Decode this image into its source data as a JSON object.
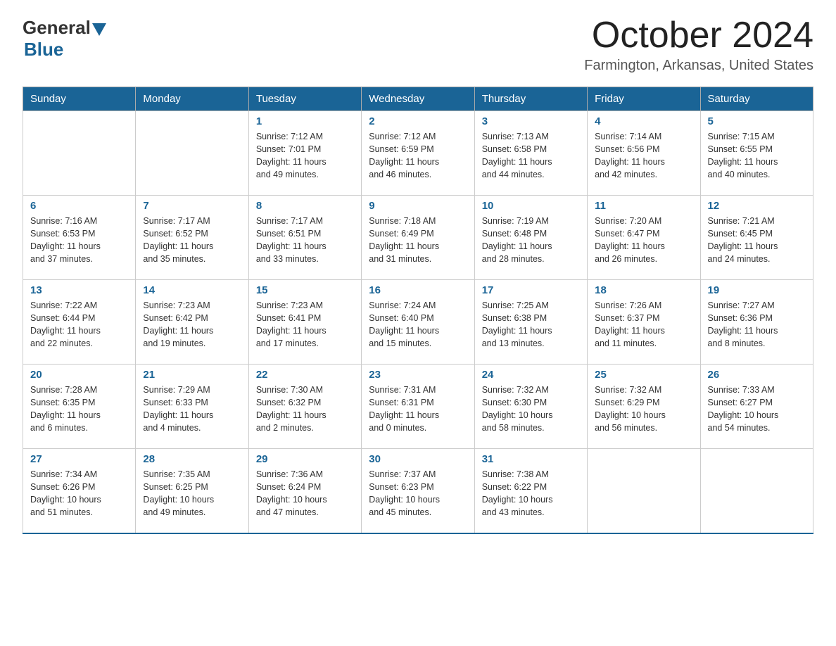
{
  "header": {
    "logo_general": "General",
    "logo_blue": "Blue",
    "month_title": "October 2024",
    "location": "Farmington, Arkansas, United States"
  },
  "days_of_week": [
    "Sunday",
    "Monday",
    "Tuesday",
    "Wednesday",
    "Thursday",
    "Friday",
    "Saturday"
  ],
  "weeks": [
    [
      {
        "day": "",
        "info": ""
      },
      {
        "day": "",
        "info": ""
      },
      {
        "day": "1",
        "info": "Sunrise: 7:12 AM\nSunset: 7:01 PM\nDaylight: 11 hours\nand 49 minutes."
      },
      {
        "day": "2",
        "info": "Sunrise: 7:12 AM\nSunset: 6:59 PM\nDaylight: 11 hours\nand 46 minutes."
      },
      {
        "day": "3",
        "info": "Sunrise: 7:13 AM\nSunset: 6:58 PM\nDaylight: 11 hours\nand 44 minutes."
      },
      {
        "day": "4",
        "info": "Sunrise: 7:14 AM\nSunset: 6:56 PM\nDaylight: 11 hours\nand 42 minutes."
      },
      {
        "day": "5",
        "info": "Sunrise: 7:15 AM\nSunset: 6:55 PM\nDaylight: 11 hours\nand 40 minutes."
      }
    ],
    [
      {
        "day": "6",
        "info": "Sunrise: 7:16 AM\nSunset: 6:53 PM\nDaylight: 11 hours\nand 37 minutes."
      },
      {
        "day": "7",
        "info": "Sunrise: 7:17 AM\nSunset: 6:52 PM\nDaylight: 11 hours\nand 35 minutes."
      },
      {
        "day": "8",
        "info": "Sunrise: 7:17 AM\nSunset: 6:51 PM\nDaylight: 11 hours\nand 33 minutes."
      },
      {
        "day": "9",
        "info": "Sunrise: 7:18 AM\nSunset: 6:49 PM\nDaylight: 11 hours\nand 31 minutes."
      },
      {
        "day": "10",
        "info": "Sunrise: 7:19 AM\nSunset: 6:48 PM\nDaylight: 11 hours\nand 28 minutes."
      },
      {
        "day": "11",
        "info": "Sunrise: 7:20 AM\nSunset: 6:47 PM\nDaylight: 11 hours\nand 26 minutes."
      },
      {
        "day": "12",
        "info": "Sunrise: 7:21 AM\nSunset: 6:45 PM\nDaylight: 11 hours\nand 24 minutes."
      }
    ],
    [
      {
        "day": "13",
        "info": "Sunrise: 7:22 AM\nSunset: 6:44 PM\nDaylight: 11 hours\nand 22 minutes."
      },
      {
        "day": "14",
        "info": "Sunrise: 7:23 AM\nSunset: 6:42 PM\nDaylight: 11 hours\nand 19 minutes."
      },
      {
        "day": "15",
        "info": "Sunrise: 7:23 AM\nSunset: 6:41 PM\nDaylight: 11 hours\nand 17 minutes."
      },
      {
        "day": "16",
        "info": "Sunrise: 7:24 AM\nSunset: 6:40 PM\nDaylight: 11 hours\nand 15 minutes."
      },
      {
        "day": "17",
        "info": "Sunrise: 7:25 AM\nSunset: 6:38 PM\nDaylight: 11 hours\nand 13 minutes."
      },
      {
        "day": "18",
        "info": "Sunrise: 7:26 AM\nSunset: 6:37 PM\nDaylight: 11 hours\nand 11 minutes."
      },
      {
        "day": "19",
        "info": "Sunrise: 7:27 AM\nSunset: 6:36 PM\nDaylight: 11 hours\nand 8 minutes."
      }
    ],
    [
      {
        "day": "20",
        "info": "Sunrise: 7:28 AM\nSunset: 6:35 PM\nDaylight: 11 hours\nand 6 minutes."
      },
      {
        "day": "21",
        "info": "Sunrise: 7:29 AM\nSunset: 6:33 PM\nDaylight: 11 hours\nand 4 minutes."
      },
      {
        "day": "22",
        "info": "Sunrise: 7:30 AM\nSunset: 6:32 PM\nDaylight: 11 hours\nand 2 minutes."
      },
      {
        "day": "23",
        "info": "Sunrise: 7:31 AM\nSunset: 6:31 PM\nDaylight: 11 hours\nand 0 minutes."
      },
      {
        "day": "24",
        "info": "Sunrise: 7:32 AM\nSunset: 6:30 PM\nDaylight: 10 hours\nand 58 minutes."
      },
      {
        "day": "25",
        "info": "Sunrise: 7:32 AM\nSunset: 6:29 PM\nDaylight: 10 hours\nand 56 minutes."
      },
      {
        "day": "26",
        "info": "Sunrise: 7:33 AM\nSunset: 6:27 PM\nDaylight: 10 hours\nand 54 minutes."
      }
    ],
    [
      {
        "day": "27",
        "info": "Sunrise: 7:34 AM\nSunset: 6:26 PM\nDaylight: 10 hours\nand 51 minutes."
      },
      {
        "day": "28",
        "info": "Sunrise: 7:35 AM\nSunset: 6:25 PM\nDaylight: 10 hours\nand 49 minutes."
      },
      {
        "day": "29",
        "info": "Sunrise: 7:36 AM\nSunset: 6:24 PM\nDaylight: 10 hours\nand 47 minutes."
      },
      {
        "day": "30",
        "info": "Sunrise: 7:37 AM\nSunset: 6:23 PM\nDaylight: 10 hours\nand 45 minutes."
      },
      {
        "day": "31",
        "info": "Sunrise: 7:38 AM\nSunset: 6:22 PM\nDaylight: 10 hours\nand 43 minutes."
      },
      {
        "day": "",
        "info": ""
      },
      {
        "day": "",
        "info": ""
      }
    ]
  ]
}
